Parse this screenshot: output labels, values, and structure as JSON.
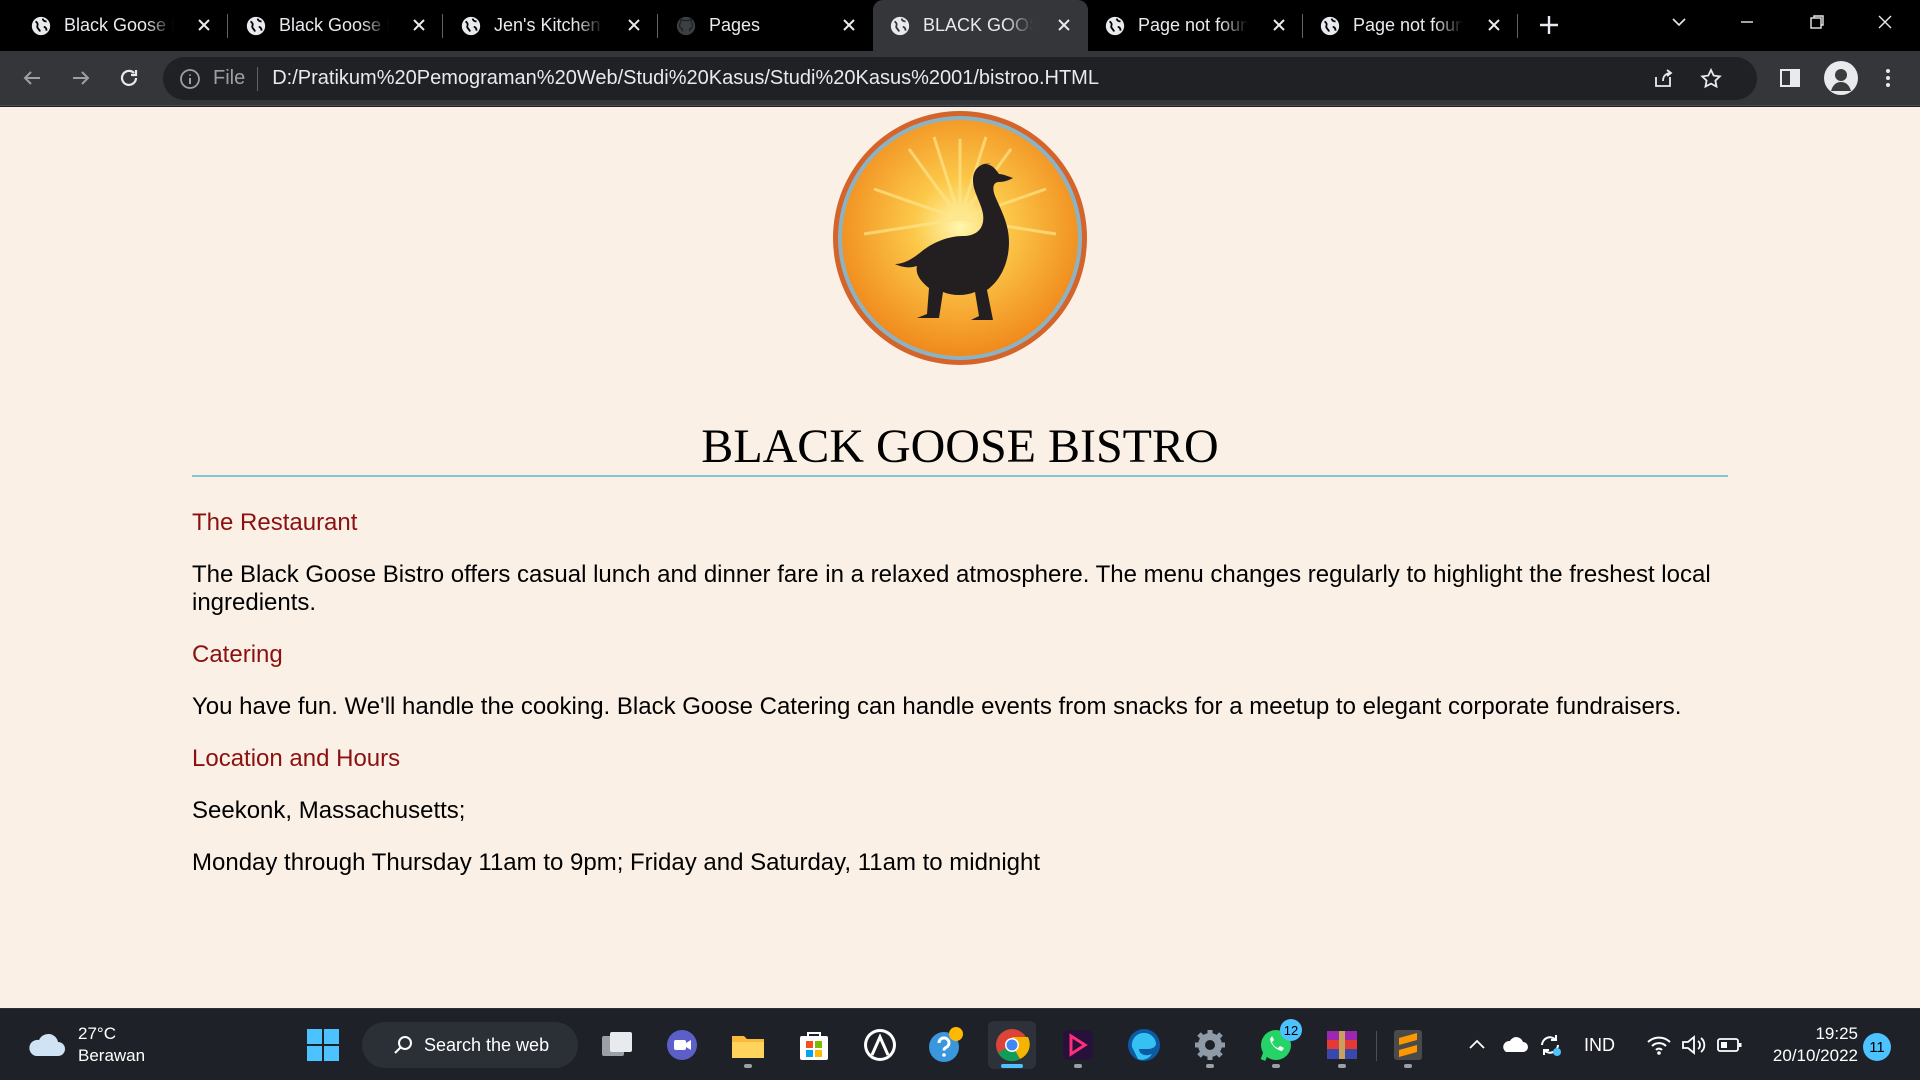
{
  "browser": {
    "tabs": [
      {
        "title": "Black Goose Bistro",
        "active": false,
        "icon": "globe-icon"
      },
      {
        "title": "Black Goose Bakery",
        "active": false,
        "icon": "globe-icon"
      },
      {
        "title": "Jen's Kitchen",
        "active": false,
        "icon": "globe-icon"
      },
      {
        "title": "Pages",
        "active": false,
        "icon": "github-icon"
      },
      {
        "title": "BLACK GOOSE BISTRO",
        "active": true,
        "icon": "globe-icon"
      },
      {
        "title": "Page not found",
        "active": false,
        "icon": "globe-icon"
      },
      {
        "title": "Page not found",
        "active": false,
        "icon": "globe-icon"
      }
    ],
    "address": {
      "scheme": "File",
      "url": "D:/Pratikum%20Pemograman%20Web/Studi%20Kasus/Studi%20Kasus%2001/bistroo.HTML"
    }
  },
  "page": {
    "title": "BLACK GOOSE BISTRO",
    "sections": [
      {
        "heading": "The Restaurant",
        "paragraphs": [
          "The Black Goose Bistro offers casual lunch and dinner fare in a relaxed atmosphere. The menu changes regularly to highlight the freshest local ingredients."
        ]
      },
      {
        "heading": "Catering",
        "paragraphs": [
          "You have fun. We'll handle the cooking. Black Goose Catering can handle events from snacks for a meetup to elegant corporate fundraisers."
        ]
      },
      {
        "heading": "Location and Hours",
        "paragraphs": [
          "Seekonk, Massachusetts;",
          "Monday through Thursday 11am to 9pm; Friday and Saturday, 11am to midnight"
        ]
      }
    ],
    "colors": {
      "background": "#faf0e6",
      "heading": "#8b1111",
      "rule": "#7ec8d6"
    }
  },
  "taskbar": {
    "weather": {
      "temp": "27°C",
      "condition": "Berawan"
    },
    "search_label": "Search the web",
    "apps": [
      "start-icon",
      "search-icon",
      "task-view-icon",
      "teams-icon",
      "file-explorer-icon",
      "store-icon",
      "app-icon",
      "help-icon",
      "chrome-icon",
      "media-icon",
      "edge-icon",
      "settings-icon",
      "whatsapp-icon",
      "winrar-icon",
      "sublime-icon"
    ],
    "whatsapp_badge": "12",
    "language": "IND",
    "time": "19:25",
    "date": "20/10/2022",
    "notifications": "11"
  }
}
